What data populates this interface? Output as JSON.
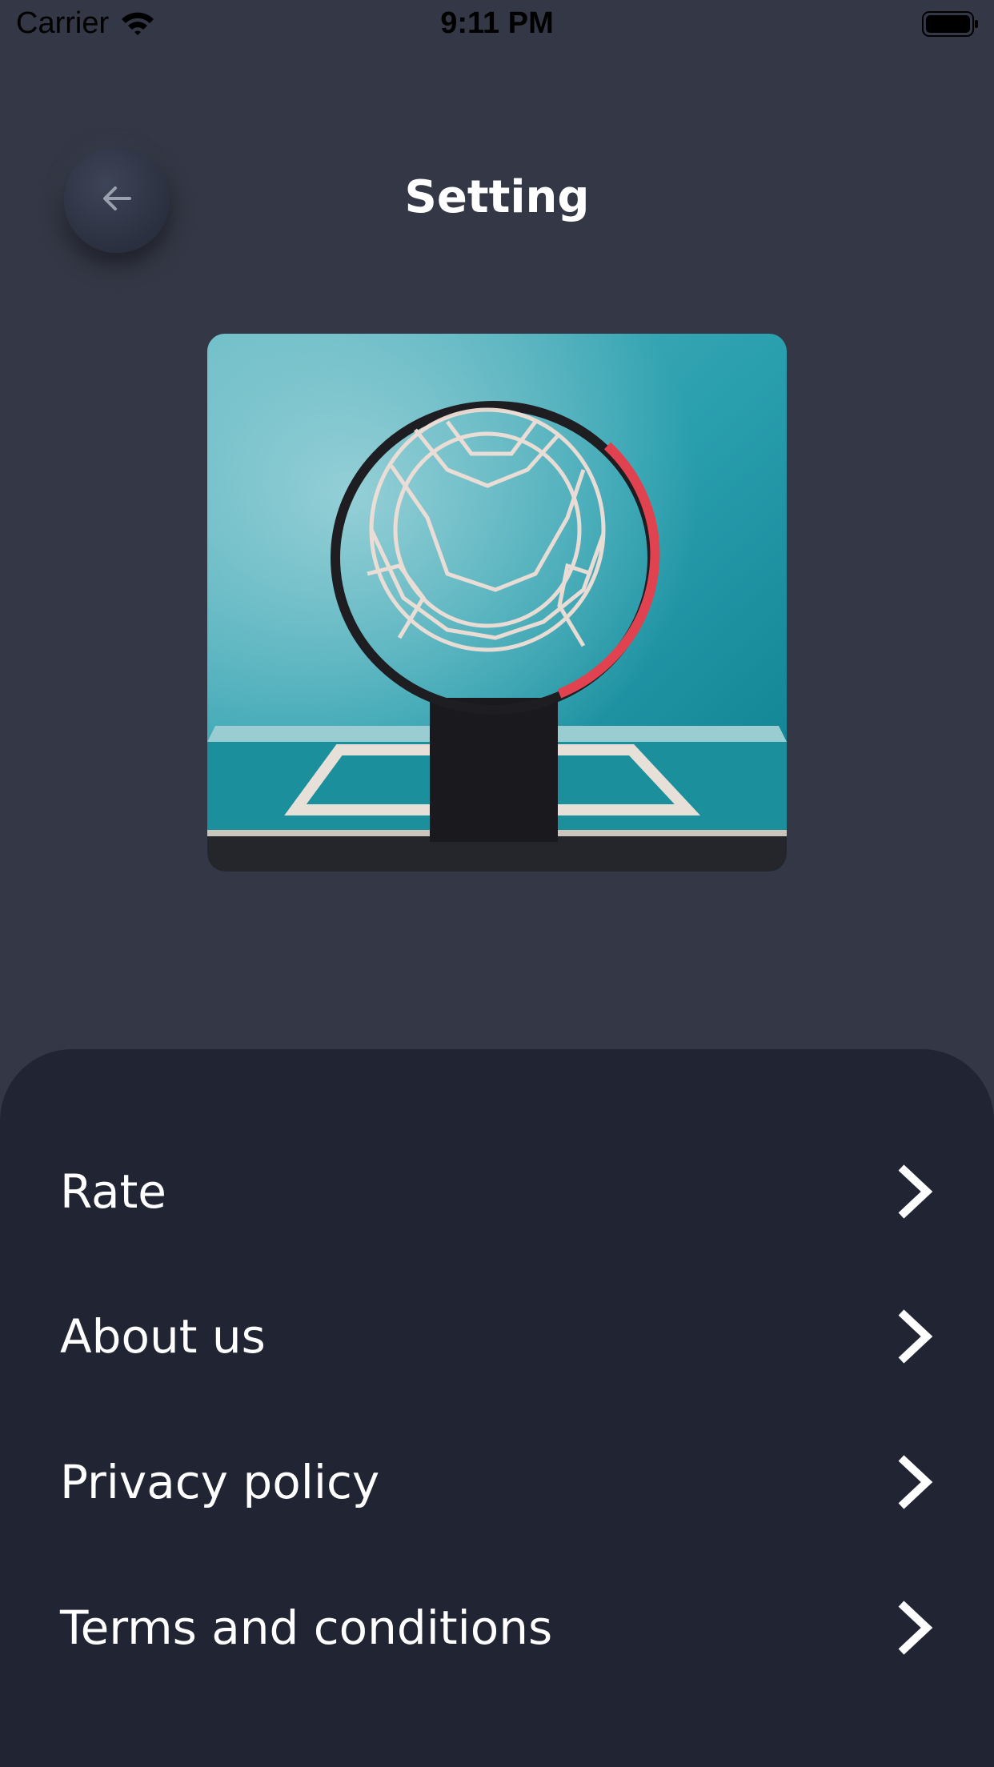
{
  "status_bar": {
    "carrier": "Carrier",
    "time": "9:11 PM",
    "icons": [
      "wifi-icon",
      "battery-icon"
    ]
  },
  "header": {
    "title": "Setting",
    "back_icon": "arrow-left-icon"
  },
  "hero": {
    "image_subject": "basketball hoop and net seen from below against a teal backboard"
  },
  "menu": {
    "items": [
      {
        "label": "Rate",
        "icon": "chevron-right-icon"
      },
      {
        "label": "About us",
        "icon": "chevron-right-icon"
      },
      {
        "label": "Privacy policy",
        "icon": "chevron-right-icon"
      },
      {
        "label": "Terms and conditions",
        "icon": "chevron-right-icon"
      }
    ]
  },
  "colors": {
    "background": "#343846",
    "sheet": "#212433",
    "text": "#ffffff"
  }
}
